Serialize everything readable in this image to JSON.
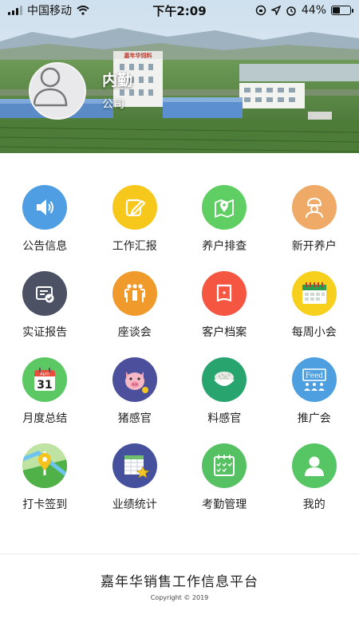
{
  "status_bar": {
    "carrier": "中国移动",
    "time": "下午2:09",
    "battery": "44%",
    "battery_level": 0.44
  },
  "header": {
    "building_sign": "嘉年华饲料",
    "user_name": "内勤",
    "company": "公司"
  },
  "menu": [
    {
      "label": "公告信息",
      "icon": "megaphone-icon",
      "color": "#4f9de3"
    },
    {
      "label": "工作汇报",
      "icon": "edit-icon",
      "color": "#f7c81c"
    },
    {
      "label": "养户排查",
      "icon": "map-pin-icon",
      "color": "#5fcf64"
    },
    {
      "label": "新开养户",
      "icon": "worker-icon",
      "color": "#eeaa66"
    },
    {
      "label": "实证报告",
      "icon": "report-icon",
      "color": "#4c5164"
    },
    {
      "label": "座谈会",
      "icon": "meeting-icon",
      "color": "#f09a2b"
    },
    {
      "label": "客户档案",
      "icon": "folder-icon",
      "color": "#f45642"
    },
    {
      "label": "每周小会",
      "icon": "calendar-icon",
      "color": "#f7cf1d"
    },
    {
      "label": "月度总结",
      "icon": "calendar-31-icon",
      "color": "#5cc864",
      "day": "31",
      "month": "April"
    },
    {
      "label": "猪感官",
      "icon": "pig-icon",
      "color": "#4b4f9c"
    },
    {
      "label": "料感官",
      "icon": "feed-bowl-icon",
      "color": "#28a46f"
    },
    {
      "label": "推广会",
      "icon": "feed-board-icon",
      "color": "#4d9fe0",
      "text": "Feed"
    },
    {
      "label": "打卡签到",
      "icon": "location-map-icon",
      "color": "#8ad062"
    },
    {
      "label": "业绩统计",
      "icon": "spreadsheet-star-icon",
      "color": "#45519c"
    },
    {
      "label": "考勤管理",
      "icon": "checklist-icon",
      "color": "#55c162"
    },
    {
      "label": "我的",
      "icon": "user-icon",
      "color": "#56c563"
    }
  ],
  "footer": {
    "title": "嘉年华销售工作信息平台",
    "copyright": "Copyright © 2019"
  }
}
